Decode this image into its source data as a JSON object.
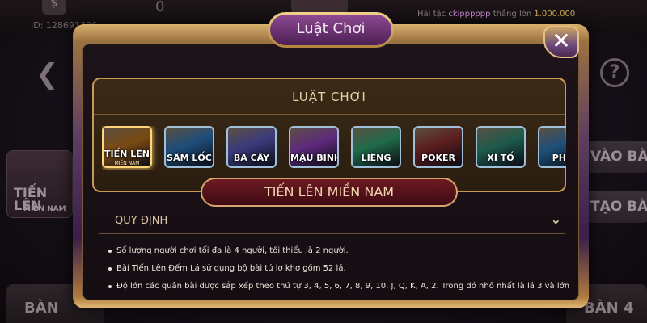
{
  "background": {
    "currency_icon": "$",
    "balance": "0",
    "player_id": "ID: 128691436",
    "ticker": {
      "prefix": "Hải tặc",
      "name": "ckipppppp",
      "mid": "thắng lớn",
      "amount": "1.000.000"
    },
    "tile_label_top": "TIẾN LÊN",
    "tile_label_bottom": "MIỀN NAM",
    "join_button": "VÀO BÀN",
    "create_button": "TẠO BÀN",
    "solo_label": "BÀN SOLO",
    "table_four_label": "BÀN 4"
  },
  "modal": {
    "title": "Luật Chơi",
    "close_icon": "close-icon",
    "panel_title": "LUẬT CHƠI",
    "games": [
      {
        "label": "TIẾN LÊN",
        "sub": "MIỀN NAM",
        "active": true,
        "color": "#7a4a12"
      },
      {
        "label": "SÂM LỐC",
        "sub": "",
        "active": false,
        "color": "#1d4d7a"
      },
      {
        "label": "BA CÂY",
        "sub": "",
        "active": false,
        "color": "#3b3b7d"
      },
      {
        "label": "MẬU BINH",
        "sub": "",
        "active": false,
        "color": "#5e2a7d"
      },
      {
        "label": "LIÊNG",
        "sub": "",
        "active": false,
        "color": "#1f6b4a"
      },
      {
        "label": "POKER",
        "sub": "",
        "active": false,
        "color": "#5b1d1d"
      },
      {
        "label": "XÌ TỐ",
        "sub": "",
        "active": false,
        "color": "#1d5b4c"
      },
      {
        "label": "PHỎ",
        "sub": "",
        "active": false,
        "color": "#1d4f7a"
      }
    ],
    "selected_game": "TIẾN LÊN MIỀN NAM",
    "section_label": "QUY ĐỊNH",
    "rules": [
      "Số lượng người chơi tối đa là 4 người, tối thiểu là 2 người.",
      "Bài Tiến Lên Đếm Lá sử dụng bộ bài tú lơ khơ gồm 52 lá.",
      "Độ lớn các quân bài được sắp xếp theo thứ tự 3, 4, 5, 6, 7, 8, 9, 10, J, Q, K, A, 2. Trong đó nhỏ nhất là lá 3 và lớn"
    ]
  }
}
